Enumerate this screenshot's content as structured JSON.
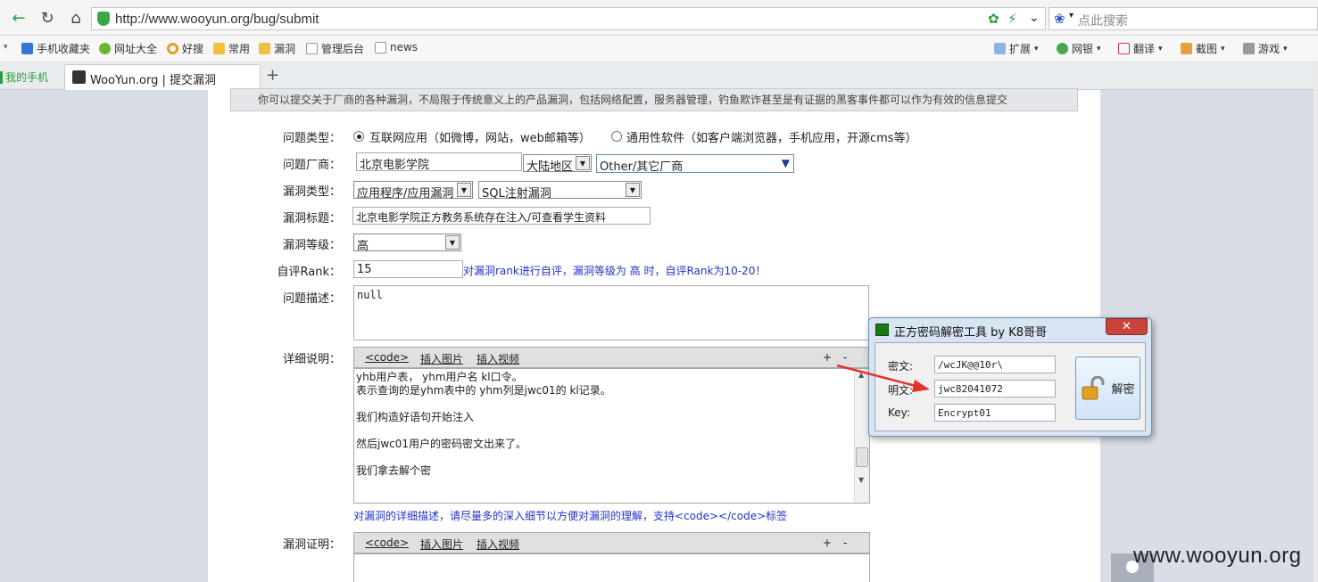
{
  "browser": {
    "url": "http://www.wooyun.org/bug/submit",
    "search_placeholder": "点此搜索",
    "bookmarks": [
      "手机收藏夹",
      "网址大全",
      "好搜",
      "常用",
      "漏洞",
      "管理后台",
      "news"
    ],
    "toolbar_right": [
      "扩展",
      "网银",
      "翻译",
      "截图",
      "游戏"
    ],
    "tabs": [
      "我的手机",
      "WooYun.org | 提交漏洞"
    ],
    "new_tab": "+"
  },
  "page": {
    "notice": "你可以提交关于厂商的各种漏洞，不局限于传统意义上的产品漏洞，包括网络配置，服务器管理，钓鱼欺诈甚至是有证据的黑客事件都可以作为有效的信息提交",
    "form": {
      "type_label": "问题类型：",
      "type_option_1": "互联网应用（如微博，网站，web邮箱等）",
      "type_option_2": "通用性软件（如客户端浏览器，手机应用，开源cms等）",
      "vendor_label": "问题厂商：",
      "vendor_value": "北京电影学院",
      "region_value": "大陆地区",
      "vendor_select": "Other/其它厂商",
      "vuln_type_label": "漏洞类型：",
      "vuln_type_1": "应用程序/应用漏洞",
      "vuln_type_2": "SQL注射漏洞",
      "title_label": "漏洞标题：",
      "title_value": "北京电影学院正方教务系统存在注入/可查看学生资料",
      "level_label": "漏洞等级：",
      "level_value": "高",
      "rank_label": "自评Rank：",
      "rank_value": "15",
      "rank_hint": "对漏洞rank进行自评，漏洞等级为 高 时，自评Rank为10-20！",
      "desc_label": "问题描述：",
      "desc_value": "null",
      "detail_label": "详细说明：",
      "editor_code": "<code>",
      "editor_image": "插入图片",
      "editor_video": "插入视频",
      "editor_plus": "+",
      "editor_minus": "-",
      "detail_lines": [
        "yhb用户表，   yhm用户名     kl口令。",
        "表示查询的是yhm表中的 yhm列是jwc01的 kl记录。",
        "",
        "我们构造好语句开始注入",
        "",
        "然后jwc01用户的密码密文出来了。",
        "",
        "我们拿去解个密"
      ],
      "detail_hint": "对漏洞的详细描述，请尽量多的深入细节以方便对漏洞的理解，支持<code></code>标签",
      "proof_label": "漏洞证明："
    }
  },
  "dialog": {
    "title": "正方密码解密工具  by K8哥哥",
    "close": "✕",
    "cipher_label": "密文:",
    "cipher_value": "/wcJK@@10r\\",
    "plain_label": "明文:",
    "plain_value": "jwc82041072",
    "key_label": "Key:",
    "key_value": "Encrypt01",
    "decrypt_label": "解密"
  },
  "watermark": "www.wooyun.org",
  "colors": {
    "accent": "#2233cc",
    "close_red": "#c8443a",
    "arrow_red": "#e53030"
  }
}
